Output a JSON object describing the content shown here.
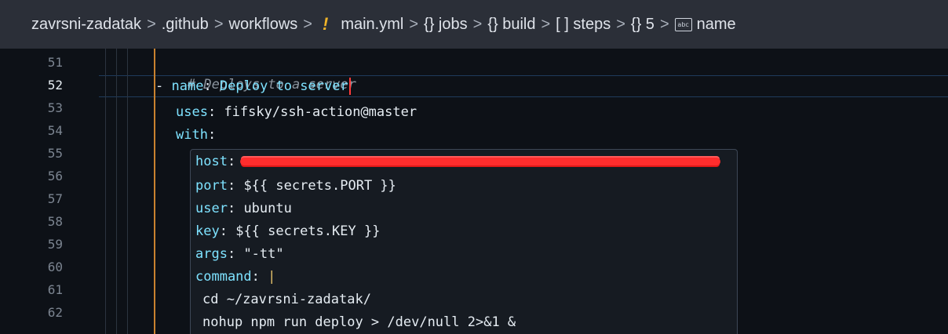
{
  "breadcrumb": {
    "project": "zavrsni-zadatak",
    "folder1": ".github",
    "folder2": "workflows",
    "file_badge": "!",
    "file": "main.yml",
    "node1": "{} jobs",
    "node2": "{} build",
    "node3": "[ ] steps",
    "node4": "{} 5",
    "node5_icon": "abc",
    "node5": "name",
    "separator": ">"
  },
  "gutter": {
    "lines": [
      "51",
      "52",
      "53",
      "54",
      "55",
      "56",
      "57",
      "58",
      "59",
      "60",
      "61",
      "62"
    ]
  },
  "code": {
    "comment": "# Deploys to a server",
    "dash": "- ",
    "name_key": "name",
    "name_val": "Deploy to server",
    "uses_key": "uses",
    "uses_val": "fifsky/ssh-action@master",
    "with_key": "with"
  },
  "popup": {
    "host_key": "host",
    "port_key": "port",
    "port_val": "${{ secrets.PORT }}",
    "user_key": "user",
    "user_val": "ubuntu",
    "key_key": "key",
    "key_val": "${{ secrets.KEY }}",
    "args_key": "args",
    "args_val": "\"-tt\"",
    "command_key": "command",
    "command_val": "|",
    "cmd1": "cd ~/zavrsni-zadatak/",
    "cmd2": "nohup npm run deploy > /dev/null 2>&1 &"
  },
  "colors": {
    "background": "#0d1117",
    "breadcrumb_bg": "#2b2f38",
    "yaml_key": "#7ee2ff",
    "comment": "#8b949e",
    "cursor": "#ff3b3b",
    "redaction": "#ff2d2d",
    "indent_guide_active": "#c9822f"
  }
}
